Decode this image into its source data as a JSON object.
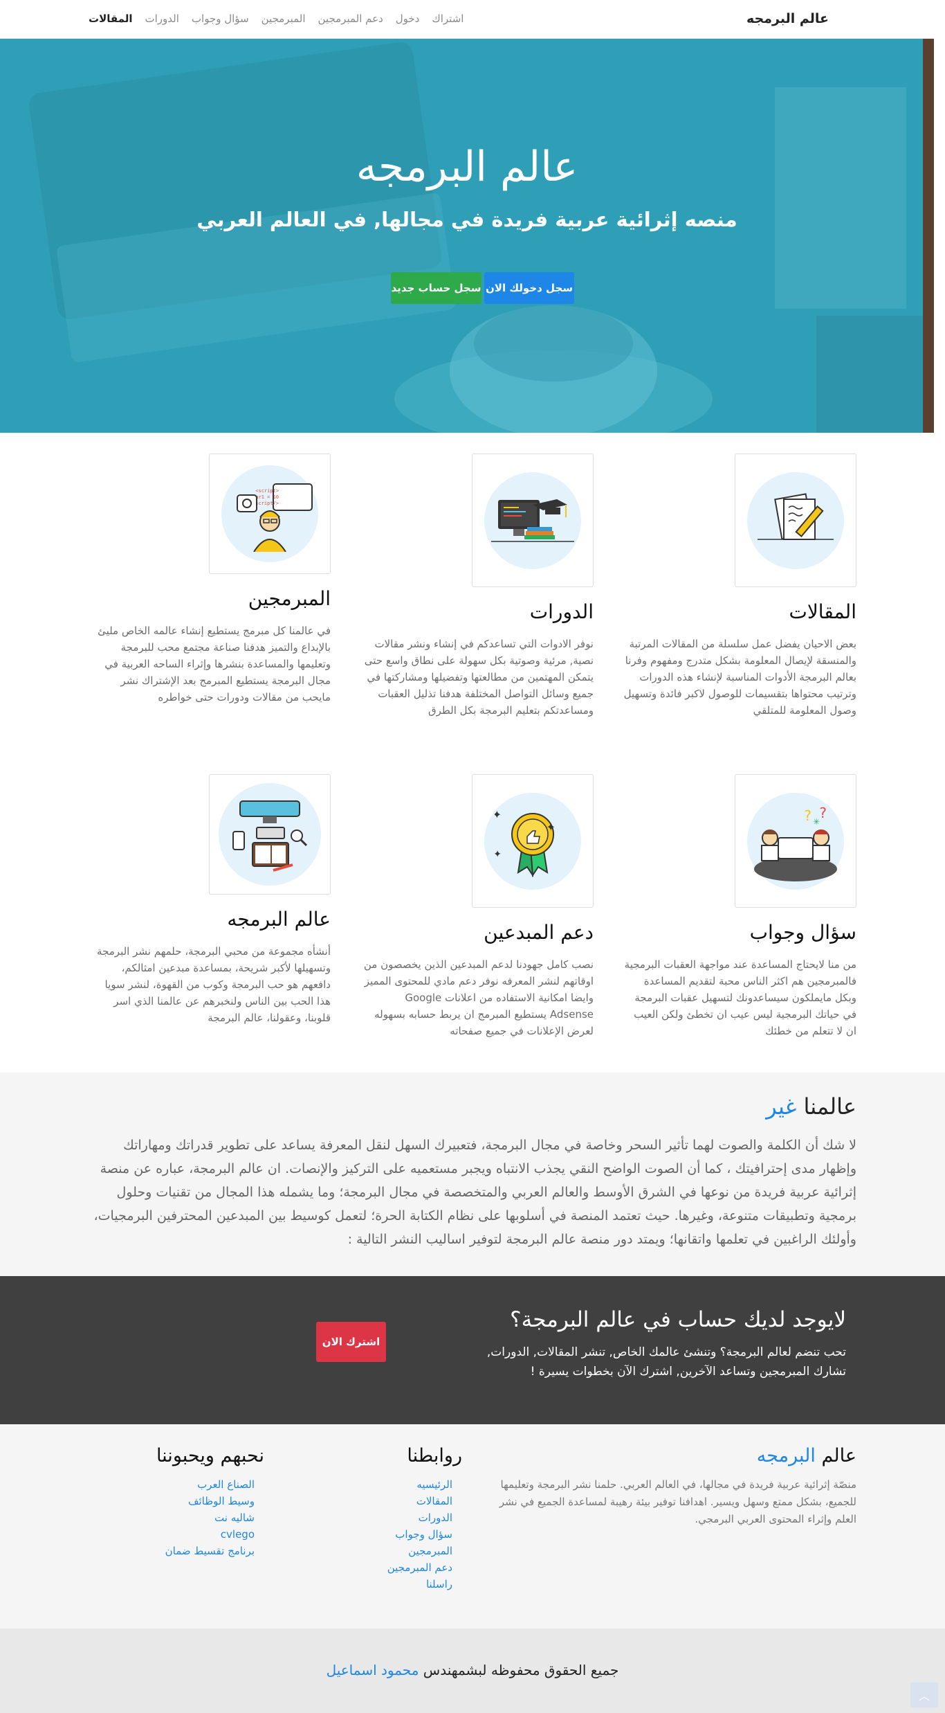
{
  "nav": {
    "brand": "عالم البرمجه",
    "links": [
      "المقالات",
      "الدورات",
      "سؤال وجواب",
      "المبرمجين",
      "دعم المبرمجين",
      "دخول",
      "اشتراك"
    ]
  },
  "hero": {
    "title": "عالم البرمجه",
    "subtitle": "منصه إثرائية عربية فريدة في مجالها, في العالم العربي",
    "login_button": "سجل دخولك الان",
    "register_button": "سجل حساب جديد"
  },
  "features": [
    {
      "title": "المقالات",
      "text": "بعض الاحيان يفضل عمل سلسلة من المقالات المرتبة والمنسقة لإيصال المعلومة بشكل متدرج ومفهوم وفرنا بعالم البرمجة الأدوات المناسبة لإنشاء هذه الدورات وترتيب محتواها بتقسيمات للوصول لاكبر فائدة وتسهيل وصول المعلومة للمتلقي",
      "icon": "articles-icon"
    },
    {
      "title": "الدورات",
      "text": "نوفر الادوات التي تساعدكم في إنشاء ونشر مقالات نصية, مرئية وصوتية بكل سهولة على نطاق واسع حتى يتمكن المهتمين من مطالعتها وتفضيلها ومشاركتها في جميع وسائل التواصل المختلفة هدفنا تذليل العقبات ومساعدتكم بتعليم البرمجة بكل الطرق",
      "icon": "courses-icon"
    },
    {
      "title": "المبرمجين",
      "text": "في عالمنا كل مبرمج يستطيع إنشاء عالمه الخاص مليئ بالإبداع والتميز هدفنا صناعة مجتمع محب للبرمجة وتعليمها والمساعدة بنشرها وإثراء الساحه العربية في مجال البرمجة يستطيع المبرمج بعد الإشتراك نشر مايحب من مقالات ودورات حتى خواطره",
      "icon": "programmers-icon"
    },
    {
      "title": "سؤال وجواب",
      "text": "من منا لايحتاج المساعدة عند مواجهة العقبات البرمجية فالمبرمجين هم اكثر الناس محبة لتقديم المساعدة وبكل مايملكون سيساعدونك لتسهيل عقبات البرمجة في حياتك البرمجية ليس عيب ان تخطئ ولكن العيب ان لا تتعلم من خطئك",
      "icon": "qa-icon"
    },
    {
      "title": "دعم المبدعين",
      "text": "نصب كامل جهودنا لدعم المبدعين الذين يخصصون من اوقاتهم لنشر المعرفه نوفر دعم مادي للمحتوى المميز وايضا امكانية الاستفاده من اعلانات Google Adsense يستطيع المبرمج ان يربط حسابه بسهوله لعرض الإعلانات في جميع صفحاته",
      "icon": "badge-icon"
    },
    {
      "title": "عالم البرمجه",
      "text": "أنشأه مجموعة من محبي البرمجة، حلمهم نشر البرمجة وتسهيلها لأكبر شريحة، بمساعدة مبدعين امثالكم، دافعهم هو حب البرمجة وكوب من القهوة، لنشر سويا هذا الحب بين الناس ولنخبرهم عن عالمنا الذي اسر قلوبنا، وعقولنا، عالم البرمجة",
      "icon": "workspace-icon"
    }
  ],
  "why": {
    "title_main": "عالمنا",
    "title_highlight": "غير",
    "text": "لا شك أن الكلمة والصوت لهما تأثير السحر وخاصة في مجال البرمجة، فتعبيرك السهل لنقل المعرفة يساعد على تطوير قدراتك ومهاراتك وإظهار مدى إحترافيتك ، كما أن الصوت الواضح النقي يجذب الانتباه ويجبر مستعميه على التركيز والإنصات. ان عالم البرمجة، عباره عن منصة إثرائية عربية فريدة من نوعها في الشرق الأوسط والعالم العربي والمتخصصة في مجال البرمجة؛ وما يشمله هذا المجال من تقنيات وحلول برمجية وتطبيقات متنوعة، وغيرها. حيث تعتمد المنصة في أسلوبها على نظام الكتابة الحرة؛ لتعمل كوسيط بين المبدعين المحترفين البرمجيات، وأولئك الراغبين في تعلمها واتقانها؛ ويمتد دور منصة عالم البرمجة لتوفير اساليب النشر التالية :"
  },
  "cta": {
    "title": "لايوجد لديك حساب في عالم البرمجة؟",
    "text": "تحب تنضم لعالم البرمجة؟ وتنشئ عالمك الخاص, تنشر المقالات, الدورات, تشارك المبرمجين وتساعد الآخرين, اشترك الآن بخطوات يسيرة !",
    "button": "اشترك الان"
  },
  "footer": {
    "about_title_main": "عالم",
    "about_title_highlight": "البرمجه",
    "about_text": "منصّة إثرائية عربية فريدة في مجالها، في العالم العربي. حلمنا نشر البرمجة وتعليمها للجميع، بشكل ممتع وسهل ويسير. اهدافنا توفير بيئة رهيبة لمساعدة الجميع في نشر العلم وإثراء المحتوى العربي البرمجي.",
    "links_title": "روابطنا",
    "links": [
      "الرئيسيه",
      "المقالات",
      "الدورات",
      "سؤال وجواب",
      "المبرمجين",
      "دعم المبرمجين",
      "راسلنا"
    ],
    "friends_title": "نحبهم ويحبوننا",
    "friends": [
      "الصناع العرب",
      "وسيط الوظائف",
      "شاليه نت",
      "cvlego",
      "برنامج تقسيط ضمان"
    ]
  },
  "copyright": {
    "text": "جميع الحقوق محفوظه لبشمهندس",
    "author": "محمود اسماعيل"
  },
  "colors": {
    "accent": "#1e86e6",
    "success": "#2eaa4a",
    "danger": "#dc3545",
    "hero_overlay": "#37a8bf",
    "cta_bg": "#404040"
  }
}
